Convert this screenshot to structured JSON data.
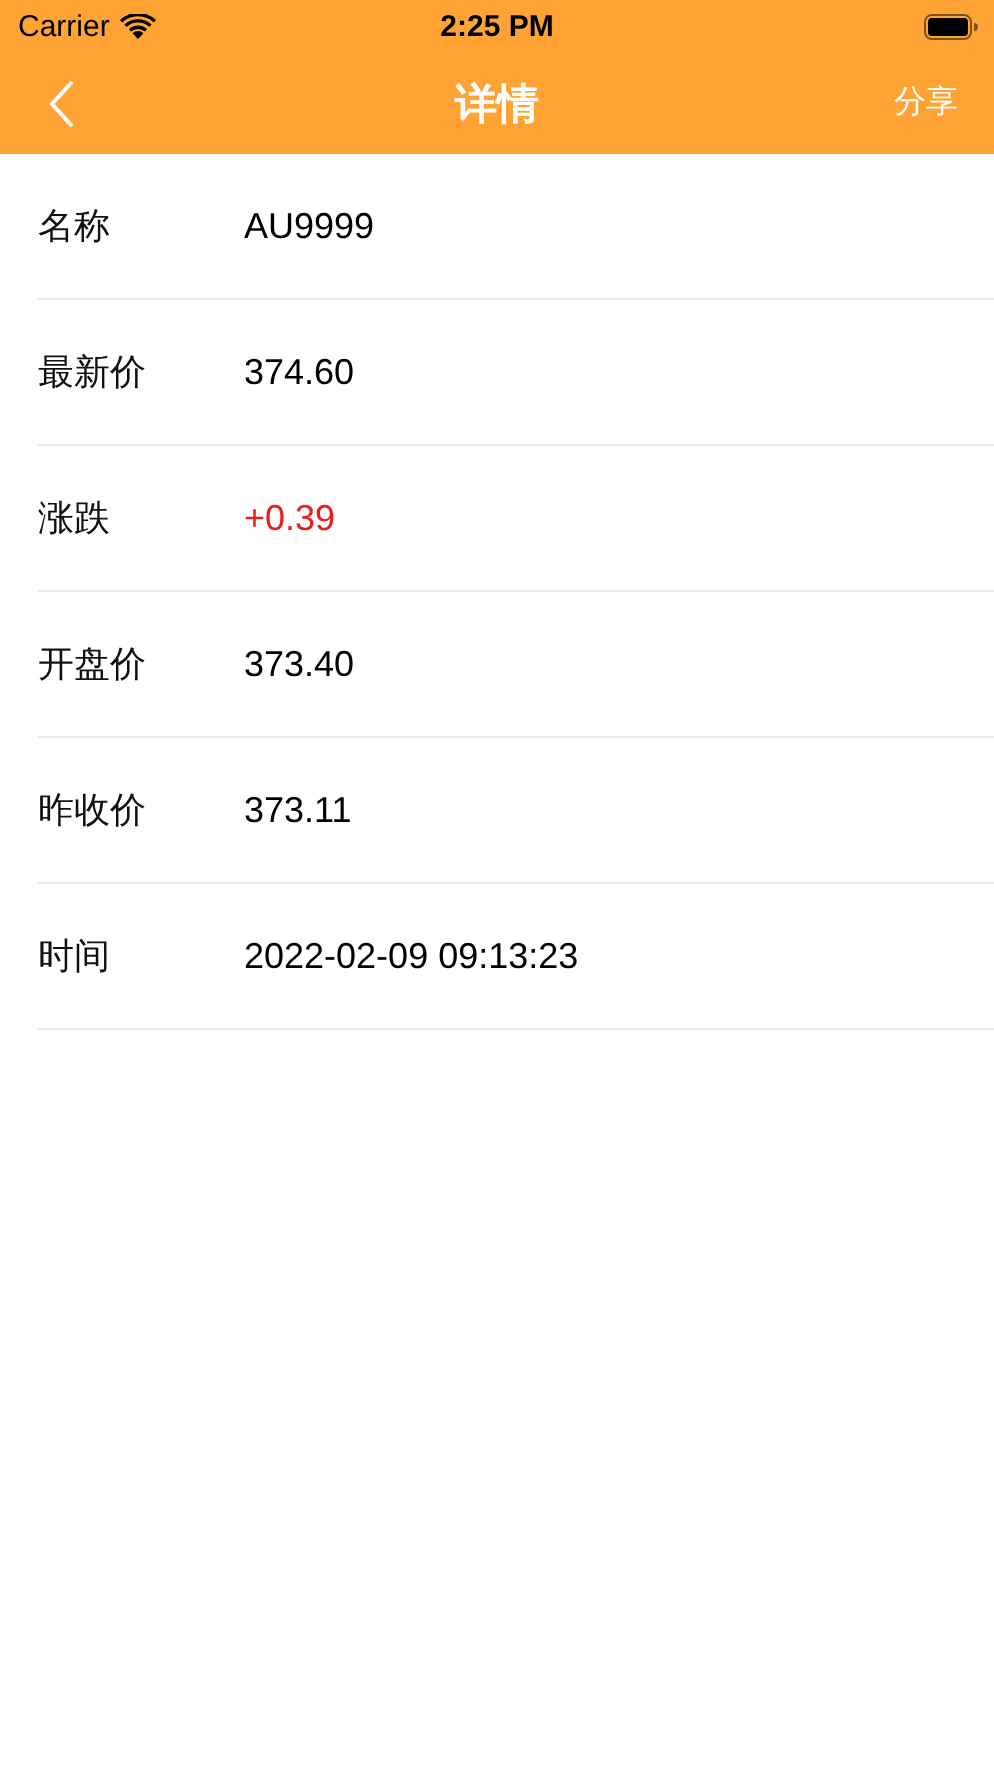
{
  "status_bar": {
    "carrier": "Carrier",
    "time": "2:25 PM"
  },
  "nav_bar": {
    "title": "详情",
    "action": "分享"
  },
  "rows": [
    {
      "label": "名称",
      "value": "AU9999",
      "color": "#000000"
    },
    {
      "label": "最新价",
      "value": "374.60",
      "color": "#000000"
    },
    {
      "label": "涨跌",
      "value": "+0.39",
      "color": "#e8201c"
    },
    {
      "label": "开盘价",
      "value": "373.40",
      "color": "#000000"
    },
    {
      "label": "昨收价",
      "value": "373.11",
      "color": "#000000"
    },
    {
      "label": "时间",
      "value": "2022-02-09 09:13:23",
      "color": "#000000"
    }
  ]
}
